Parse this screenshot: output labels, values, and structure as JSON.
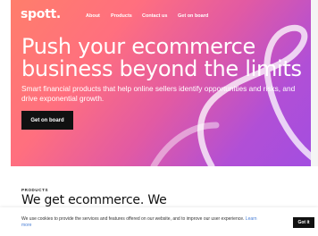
{
  "nav": {
    "logo": "spott.",
    "links": [
      "About",
      "Products",
      "Contact us",
      "Get on board"
    ]
  },
  "hero": {
    "title_line1": "Push your ecommerce",
    "title_line2": "business beyond the limits",
    "subtitle": "Smart financial products that help online sellers identify opportunities and risks, and drive exponential growth.",
    "cta_label": "Get on board",
    "gradient_colors": [
      "#ff7e6b",
      "#e25aa3",
      "#a34ee0"
    ]
  },
  "section": {
    "eyebrow": "PRODUCTS",
    "title": "We get ecommerce. We"
  },
  "cookie": {
    "text": "We use cookies to provide the services and features offered on our website, and to improve our user experience.",
    "link": "Learn more",
    "button": "Got it"
  }
}
